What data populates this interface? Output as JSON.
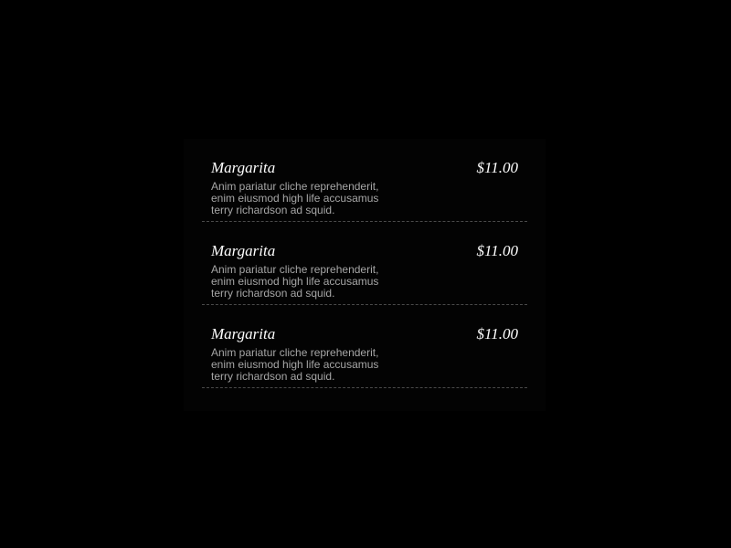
{
  "menu": {
    "items": [
      {
        "name": "Margarita",
        "price": "$11.00",
        "description": "Anim pariatur cliche reprehenderit, enim eiusmod high life accusamus terry richardson ad squid."
      },
      {
        "name": "Margarita",
        "price": "$11.00",
        "description": "Anim pariatur cliche reprehenderit, enim eiusmod high life accusamus terry richardson ad squid."
      },
      {
        "name": "Margarita",
        "price": "$11.00",
        "description": "Anim pariatur cliche reprehenderit, enim eiusmod high life accusamus terry richardson ad squid."
      }
    ]
  },
  "colors": {
    "background": "#000000",
    "name_text": "#ffffff",
    "description_text": "#a6a6a6",
    "divider": "#4a4a4a"
  }
}
